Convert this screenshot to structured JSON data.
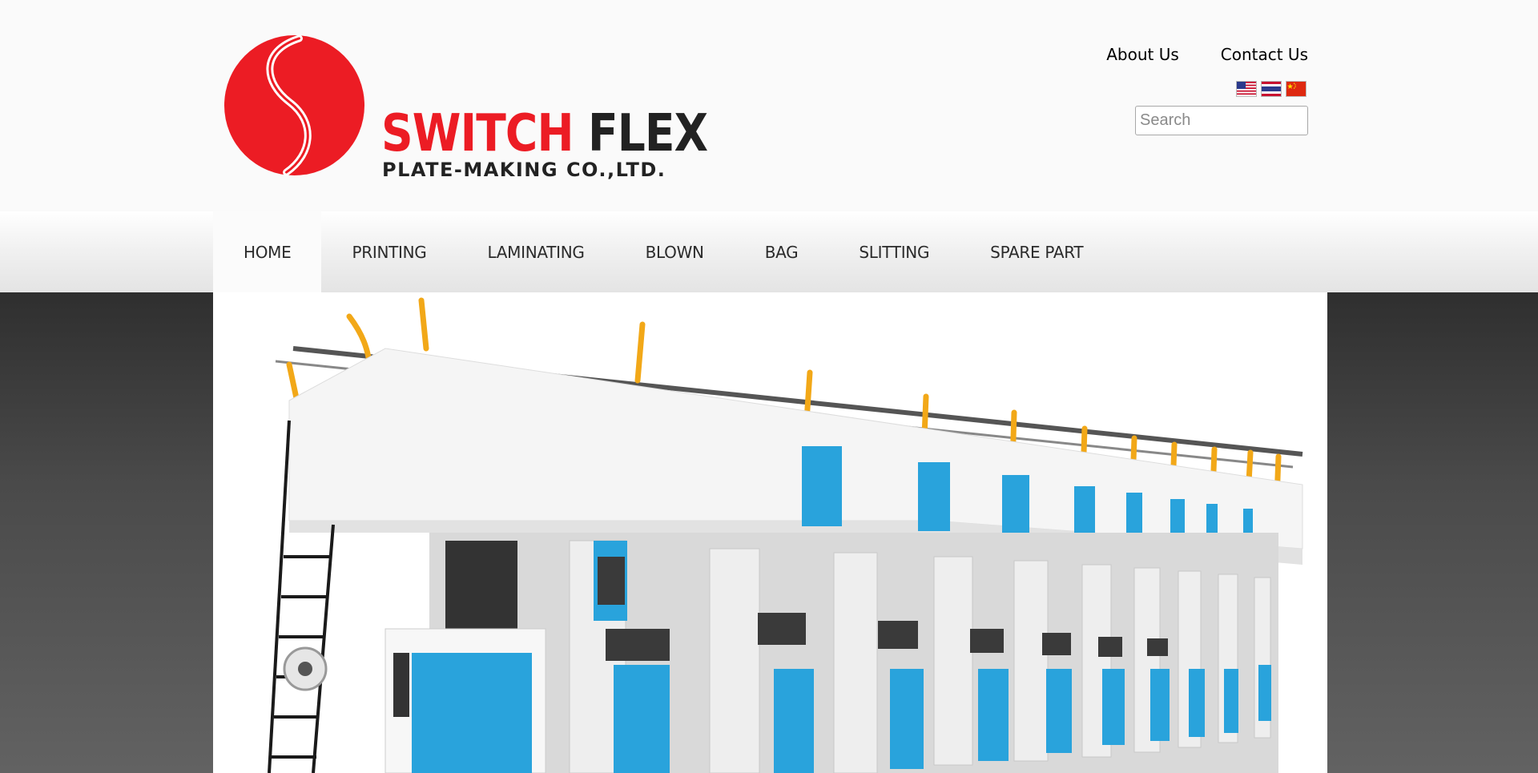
{
  "brand": {
    "name_part1": "SWITCH",
    "name_part2": "FLEX",
    "subtitle": "PLATE-MAKING CO.,LTD.",
    "logo_color": "#ec1c24"
  },
  "top_links": [
    {
      "label": "About Us"
    },
    {
      "label": "Contact Us"
    }
  ],
  "languages": [
    {
      "icon": "us-flag-icon"
    },
    {
      "icon": "thai-flag-icon"
    },
    {
      "icon": "china-flag-icon"
    }
  ],
  "search": {
    "placeholder": "Search",
    "value": ""
  },
  "nav": {
    "items": [
      {
        "label": "HOME",
        "active": true
      },
      {
        "label": "PRINTING"
      },
      {
        "label": "LAMINATING"
      },
      {
        "label": "BLOWN"
      },
      {
        "label": "BAG"
      },
      {
        "label": "SLITTING"
      },
      {
        "label": "SPARE PART"
      }
    ]
  },
  "banner": {
    "image": "rotogravure-printing-machine-image"
  },
  "colors": {
    "accent": "#ec1c24",
    "machine_blue": "#29a3dc",
    "rail_orange": "#f2a818"
  }
}
